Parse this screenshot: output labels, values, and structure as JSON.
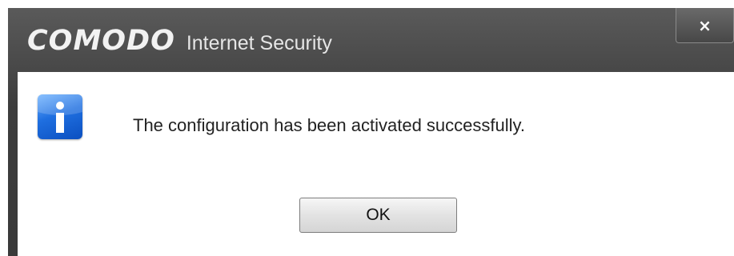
{
  "dialog": {
    "brand_logo": "COMODO",
    "product_name": "Internet Security",
    "close_label": "×",
    "message": "The configuration has been activated successfully.",
    "icon": "info-icon",
    "ok_label": "OK"
  },
  "colors": {
    "titlebar": "#3d3d3d",
    "content_bg": "#ffffff",
    "icon_blue": "#1f6fe0",
    "button_bg": "#e3e3e3"
  }
}
